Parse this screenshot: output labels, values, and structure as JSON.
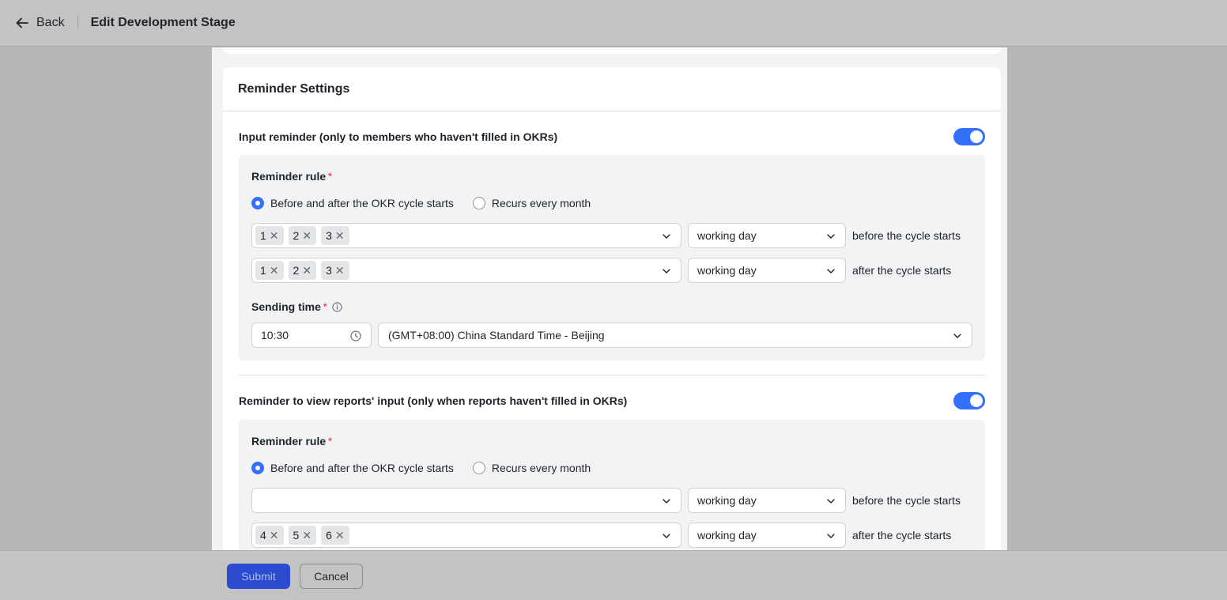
{
  "header": {
    "back_label": "Back",
    "title": "Edit Development Stage"
  },
  "card": {
    "title": "Reminder Settings"
  },
  "input_reminder": {
    "label": "Input reminder (only to members who haven't filled in OKRs)",
    "enabled": true,
    "rule_label": "Reminder rule",
    "required_mark": "*",
    "options": [
      "Before and after the OKR cycle starts",
      "Recurs every month"
    ],
    "selected_option": 0,
    "before": {
      "tags": [
        "1",
        "2",
        "3"
      ],
      "unit": "working day",
      "suffix": "before the cycle starts"
    },
    "after": {
      "tags": [
        "1",
        "2",
        "3"
      ],
      "unit": "working day",
      "suffix": "after the cycle starts"
    },
    "sending_time_label": "Sending time",
    "time": "10:30",
    "timezone": "(GMT+08:00) China Standard Time - Beijing"
  },
  "view_reminder": {
    "label": "Reminder to view reports' input (only when reports haven't filled in OKRs)",
    "enabled": true,
    "rule_label": "Reminder rule",
    "required_mark": "*",
    "options": [
      "Before and after the OKR cycle starts",
      "Recurs every month"
    ],
    "selected_option": 0,
    "before": {
      "tags": [],
      "unit": "working day",
      "suffix": "before the cycle starts"
    },
    "after": {
      "tags": [
        "4",
        "5",
        "6"
      ],
      "unit": "working day",
      "suffix": "after the cycle starts"
    }
  },
  "footer": {
    "submit_label": "Submit",
    "cancel_label": "Cancel"
  },
  "icons": {
    "back": "arrow-left-icon",
    "chevron": "chevron-down-icon",
    "clock": "clock-icon",
    "info": "info-icon",
    "tag_remove": "close-icon"
  },
  "colors": {
    "accent": "#3370ff",
    "required": "#f54a45",
    "submit_bg": "#2b4bd1"
  }
}
